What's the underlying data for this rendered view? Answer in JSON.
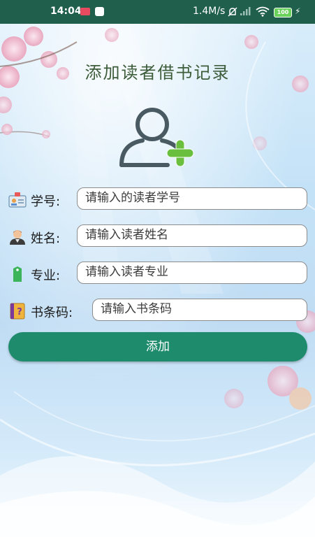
{
  "status_bar": {
    "time": "14:04",
    "network_speed": "1.4M/s",
    "battery": "100"
  },
  "page": {
    "title": "添加读者借书记录"
  },
  "form": {
    "student_id": {
      "label": "学号:",
      "placeholder": "请输入的读者学号"
    },
    "name": {
      "label": "姓名:",
      "placeholder": "请输入读者姓名"
    },
    "major": {
      "label": "专业:",
      "placeholder": "请输入读者专业"
    },
    "barcode": {
      "label": "书条码:",
      "placeholder": "请输入书条码"
    },
    "submit_label": "添加"
  },
  "icons": {
    "avatar": "add-user-icon",
    "student_id": "id-card-icon",
    "name": "person-icon",
    "major": "tag-icon",
    "barcode": "book-icon"
  },
  "colors": {
    "status_bar": "#1f5f4b",
    "title": "#3c5c3a",
    "button": "#1e8c6c",
    "avatar_outline": "#4a5a63",
    "avatar_plus": "#6bbf3f"
  }
}
